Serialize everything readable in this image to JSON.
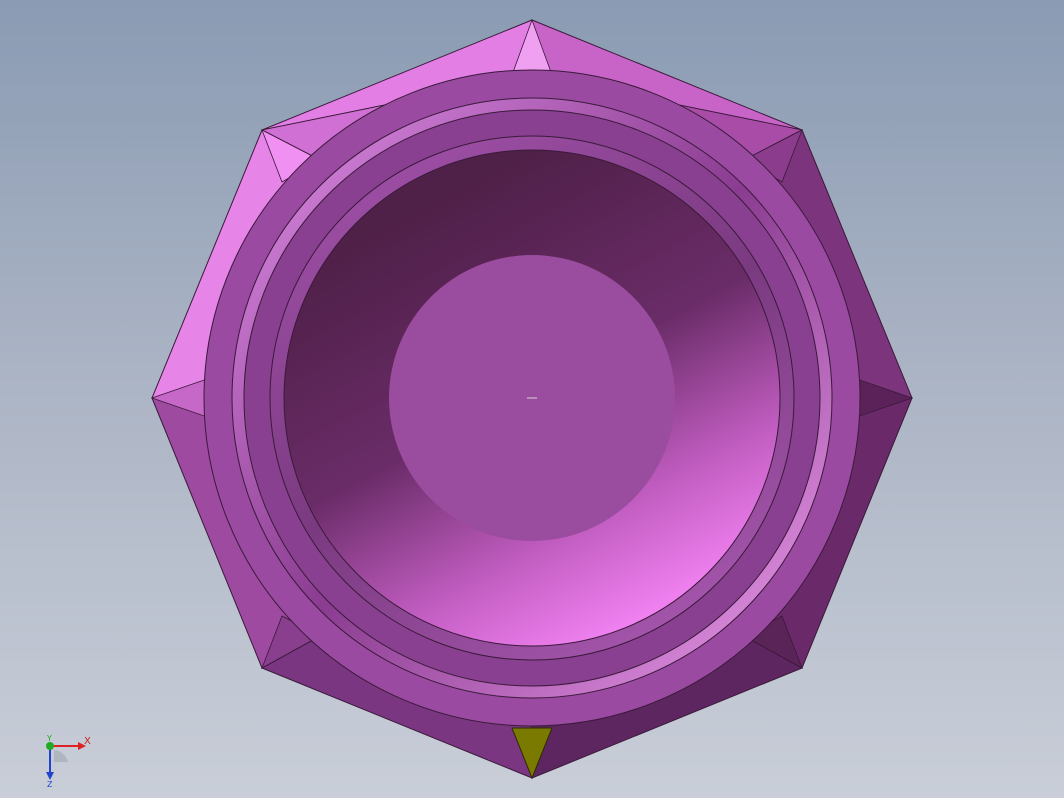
{
  "viewport": {
    "background_top": "#8a9bb3",
    "background_bottom": "#c9ced8"
  },
  "model": {
    "part_color": "#c060c8",
    "highlight_color": "#f080f0",
    "shadow_color": "#5a2a5a",
    "marker_color": "#7a7a00"
  },
  "triad": {
    "x_label": "X",
    "y_label": "Y",
    "z_label": "Z",
    "x_color": "#dd2222",
    "y_color": "#22aa22",
    "z_color": "#2244cc"
  }
}
